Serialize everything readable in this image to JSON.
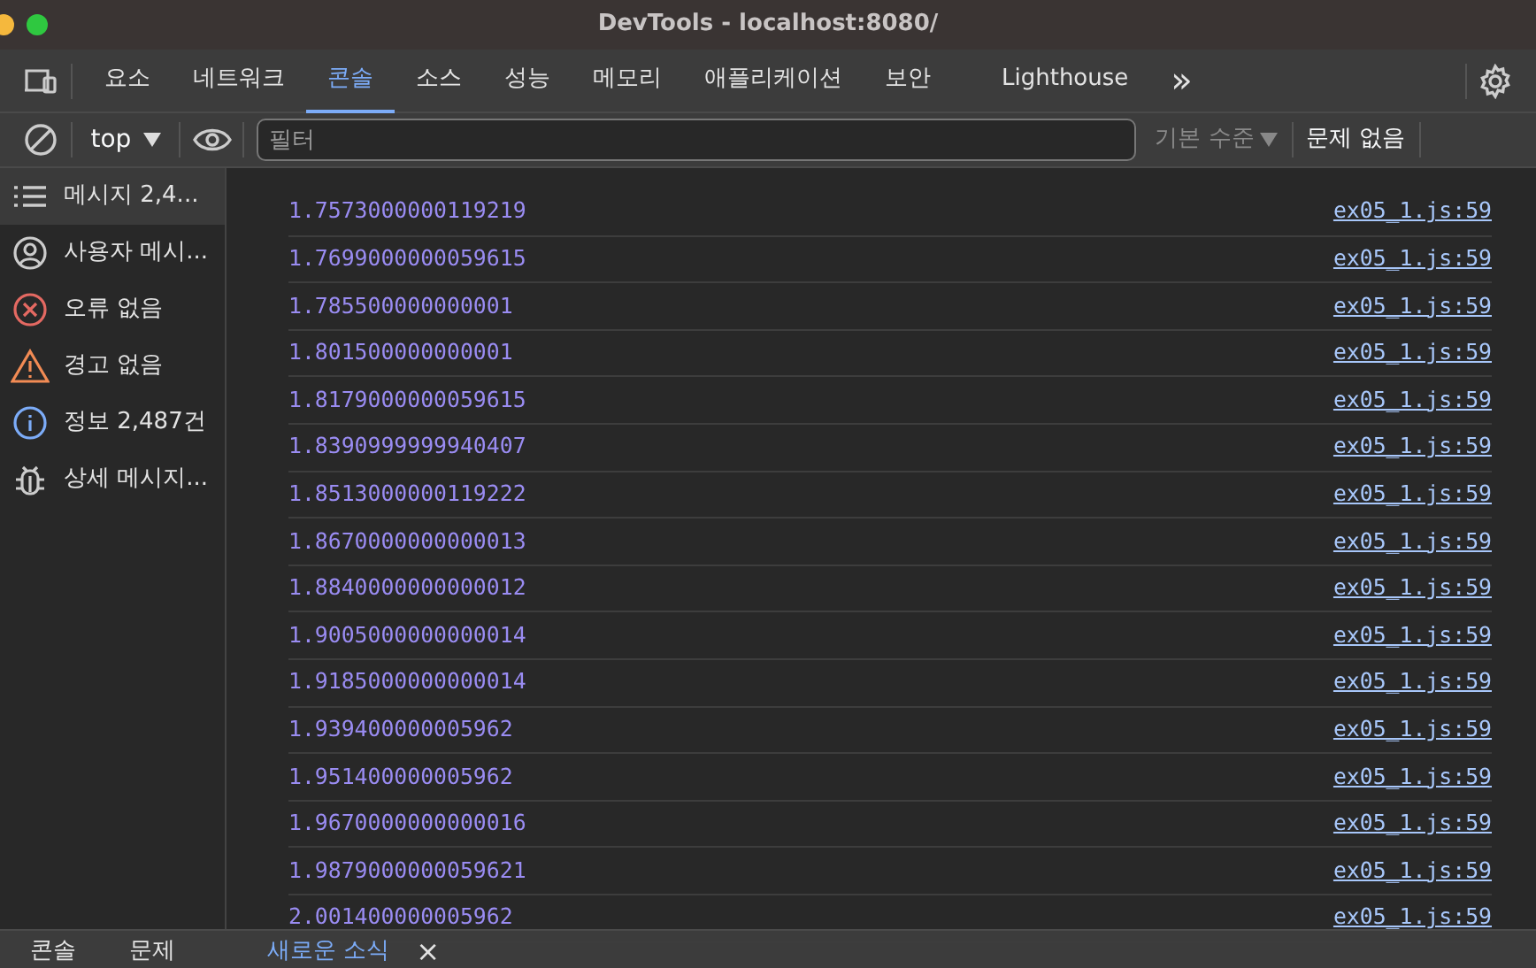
{
  "window": {
    "title": "DevTools - localhost:8080/"
  },
  "tabs": [
    {
      "label": "요소",
      "selected": false
    },
    {
      "label": "네트워크",
      "selected": false
    },
    {
      "label": "콘솔",
      "selected": true
    },
    {
      "label": "소스",
      "selected": false
    },
    {
      "label": "성능",
      "selected": false
    },
    {
      "label": "메모리",
      "selected": false
    },
    {
      "label": "애플리케이션",
      "selected": false
    },
    {
      "label": "보안",
      "selected": false
    },
    {
      "label": "Lighthouse",
      "selected": false
    }
  ],
  "more_tabs": "»",
  "toolbar": {
    "context": "top",
    "filter": {
      "placeholder": "필터"
    },
    "levels": "기본 수준",
    "issues": "문제 없음"
  },
  "sidebar": {
    "items": [
      {
        "kind": "list",
        "label": "메시지 2,4...",
        "selected": true
      },
      {
        "kind": "user",
        "label": "사용자 메시...",
        "selected": false
      },
      {
        "kind": "error",
        "label": "오류 없음",
        "selected": false
      },
      {
        "kind": "warning",
        "label": "경고 없음",
        "selected": false
      },
      {
        "kind": "info",
        "label": "정보 2,487건",
        "selected": false
      },
      {
        "kind": "verbose",
        "label": "상세 메시지...",
        "selected": false
      }
    ]
  },
  "messages": [
    {
      "text": "1.7573000000119219",
      "source": "ex05_1.js:59"
    },
    {
      "text": "1.7699000000059615",
      "source": "ex05_1.js:59"
    },
    {
      "text": "1.785500000000001",
      "source": "ex05_1.js:59"
    },
    {
      "text": "1.801500000000001",
      "source": "ex05_1.js:59"
    },
    {
      "text": "1.8179000000059615",
      "source": "ex05_1.js:59"
    },
    {
      "text": "1.8390999999940407",
      "source": "ex05_1.js:59"
    },
    {
      "text": "1.8513000000119222",
      "source": "ex05_1.js:59"
    },
    {
      "text": "1.8670000000000013",
      "source": "ex05_1.js:59"
    },
    {
      "text": "1.8840000000000012",
      "source": "ex05_1.js:59"
    },
    {
      "text": "1.9005000000000014",
      "source": "ex05_1.js:59"
    },
    {
      "text": "1.9185000000000014",
      "source": "ex05_1.js:59"
    },
    {
      "text": "1.939400000005962",
      "source": "ex05_1.js:59"
    },
    {
      "text": "1.951400000005962",
      "source": "ex05_1.js:59"
    },
    {
      "text": "1.9670000000000016",
      "source": "ex05_1.js:59"
    },
    {
      "text": "1.9879000000059621",
      "source": "ex05_1.js:59"
    },
    {
      "text": "2.001400000005962",
      "source": "ex05_1.js:59"
    }
  ],
  "drawer_tabs": [
    {
      "label": "콘솔",
      "selected": false,
      "closable": false
    },
    {
      "label": "문제",
      "selected": false,
      "closable": false
    },
    {
      "label": "새로운 소식",
      "selected": true,
      "closable": true
    }
  ],
  "close_glyph": "×"
}
